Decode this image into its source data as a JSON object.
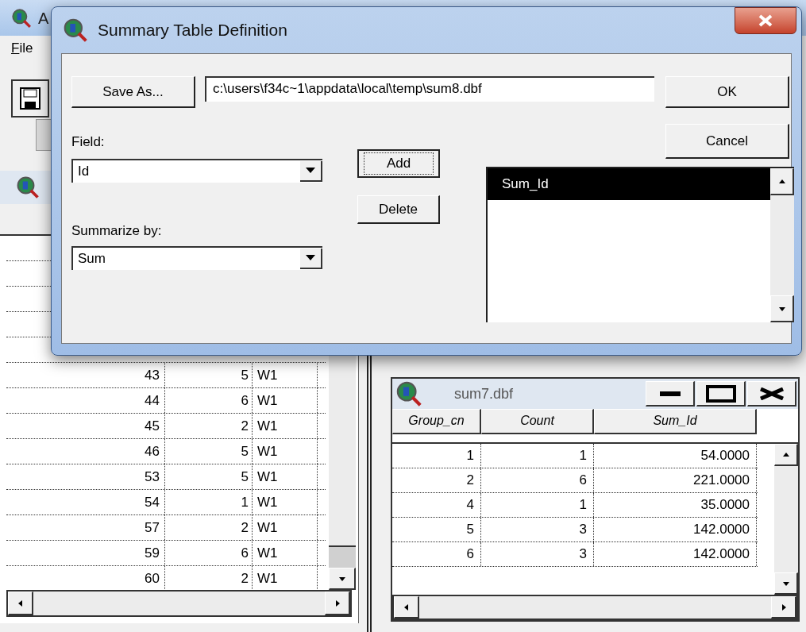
{
  "app": {
    "title": "A",
    "menu": [
      "File"
    ]
  },
  "left_table": {
    "rows": [
      [
        "43",
        "5",
        "W1"
      ],
      [
        "44",
        "6",
        "W1"
      ],
      [
        "45",
        "2",
        "W1"
      ],
      [
        "46",
        "5",
        "W1"
      ],
      [
        "53",
        "5",
        "W1"
      ],
      [
        "54",
        "1",
        "W1"
      ],
      [
        "57",
        "2",
        "W1"
      ],
      [
        "59",
        "6",
        "W1"
      ],
      [
        "60",
        "2",
        "W1"
      ]
    ]
  },
  "child_window": {
    "title": "sum7.dbf",
    "columns": [
      "Group_cn",
      "Count",
      "Sum_Id"
    ],
    "rows": [
      [
        "1",
        "1",
        "54.0000"
      ],
      [
        "2",
        "6",
        "221.0000"
      ],
      [
        "4",
        "1",
        "35.0000"
      ],
      [
        "5",
        "3",
        "142.0000"
      ],
      [
        "6",
        "3",
        "142.0000"
      ]
    ]
  },
  "dialog": {
    "title": "Summary Table Definition",
    "save_as": "Save As...",
    "path": "c:\\users\\f34c~1\\appdata\\local\\temp\\sum8.dbf",
    "ok": "OK",
    "cancel": "Cancel",
    "field_label": "Field:",
    "field_value": "Id",
    "summarize_label": "Summarize by:",
    "summarize_value": "Sum",
    "add": "Add",
    "add_focused": true,
    "delete": "Delete",
    "list_items": [
      {
        "label": "Sum_Id",
        "selected": true
      }
    ]
  }
}
